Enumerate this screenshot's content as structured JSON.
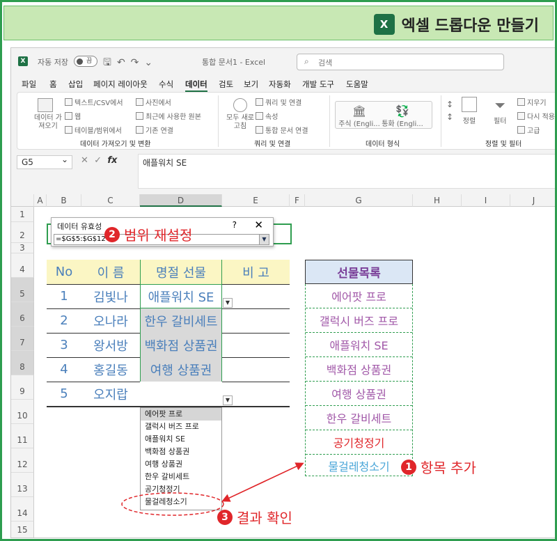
{
  "banner": {
    "logo": "X",
    "title": "엑셀 드롭다운 만들기"
  },
  "titlebar": {
    "app_icon": "X",
    "autosave_label": "자동 저장",
    "toggle_state": "끔",
    "doc_title": "통합 문서1 - Excel",
    "search_placeholder": "검색"
  },
  "menu": [
    "파일",
    "홈",
    "삽입",
    "페이지 레이아웃",
    "수식",
    "데이터",
    "검토",
    "보기",
    "자동화",
    "개발 도구",
    "도움말"
  ],
  "ribbon": {
    "get_data": "데이터 가져오기",
    "text_csv": "텍스트/CSV에서",
    "web": "웹",
    "table_range": "테이블/범위에서",
    "from_picture": "사진에서",
    "recent_sources": "최근에 사용한 원본",
    "existing_conn": "기존 연결",
    "group_get": "데이터 가져오기 및 변환",
    "refresh_all": "모두 새로 고침",
    "queries_conn": "쿼리 및 연결",
    "properties": "속성",
    "edit_links": "통합 문서 연결",
    "group_queries": "쿼리 및 연결",
    "stocks": "주식 (Engli...",
    "currency": "통화 (Engli...",
    "group_types": "데이터 형식",
    "sort": "정렬",
    "filter": "필터",
    "clear": "지우기",
    "reapply": "다시 적용",
    "advanced": "고급",
    "group_sort": "정렬 및 필터"
  },
  "formula_bar": {
    "name_box": "G5",
    "fx": "fx",
    "value": "애플워치 SE"
  },
  "columns": [
    "A",
    "B",
    "C",
    "D",
    "E",
    "F",
    "G",
    "H",
    "I",
    "J"
  ],
  "rows": [
    "1",
    "2",
    "3",
    "4",
    "5",
    "6",
    "7",
    "8",
    "9",
    "10",
    "11",
    "12",
    "13",
    "14",
    "15"
  ],
  "table": {
    "headers": [
      "No",
      "이 름",
      "명절 선물",
      "비 고"
    ],
    "rows": [
      {
        "no": "1",
        "name": "김빛나",
        "gift": "애플워치 SE"
      },
      {
        "no": "2",
        "name": "오나라",
        "gift": "한우 갈비세트"
      },
      {
        "no": "3",
        "name": "왕서방",
        "gift": "백화점 상품권"
      },
      {
        "no": "4",
        "name": "홍길동",
        "gift": "여행 상품권"
      },
      {
        "no": "5",
        "name": "오지랍",
        "gift": ""
      }
    ]
  },
  "gift_list": {
    "header": "선물목록",
    "items": [
      "에어팟 프로",
      "갤럭시 버즈 프로",
      "애플워치 SE",
      "백화점 상품권",
      "여행 상품권",
      "한우 갈비세트",
      "공기청정기",
      "물걸레청소기"
    ]
  },
  "dropdown_items": [
    "에어팟 프로",
    "갤럭시 버즈 프로",
    "애플워치 SE",
    "백화점 상품권",
    "여행 상품권",
    "한우 갈비세트",
    "공기청정기",
    "물걸레청소기"
  ],
  "dialog": {
    "title": "데이터 유효성",
    "help": "?",
    "close": "✕",
    "ref": "=$G$5:$G$12"
  },
  "annotations": [
    {
      "num": "1",
      "text": "항목 추가"
    },
    {
      "num": "2",
      "text": "범위 재설정"
    },
    {
      "num": "3",
      "text": "결과 확인"
    }
  ],
  "colors": {
    "accent": "#1e7145",
    "annotation": "#e0262a",
    "header_fill": "#fbf6c4",
    "list_header_fill": "#dbe7f5"
  }
}
